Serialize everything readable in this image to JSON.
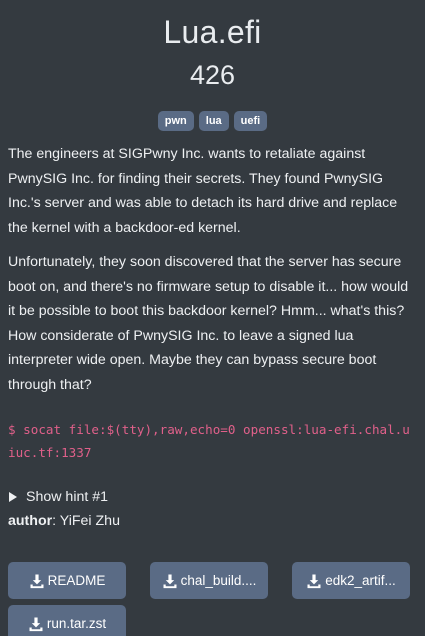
{
  "challenge": {
    "title": "Lua.efi",
    "points": "426",
    "tags": [
      "pwn",
      "lua",
      "uefi"
    ],
    "description": [
      "The engineers at SIGPwny Inc. wants to retaliate against PwnySIG Inc. for finding their secrets. They found PwnySIG Inc.'s server and was able to detach its hard drive and replace the kernel with a backdoor-ed kernel.",
      "Unfortunately, they soon discovered that the server has secure boot on, and there's no firmware setup to disable it... how would it be possible to boot this backdoor kernel? Hmm... what's this? How considerate of PwnySIG Inc. to leave a signed lua interpreter wide open. Maybe they can bypass secure boot through that?"
    ],
    "command": "$ socat file:$(tty),raw,echo=0 openssl:lua-efi.chal.uiuc.tf:1337",
    "hint_label": "Show hint #1",
    "author_label": "author",
    "author_name": "YiFei Zhu"
  },
  "downloads": [
    {
      "label": "README",
      "icon": "download-icon"
    },
    {
      "label": "chal_build....",
      "icon": "download-icon"
    },
    {
      "label": "edk2_artif...",
      "icon": "download-icon"
    },
    {
      "label": "run.tar.zst",
      "icon": "download-icon"
    }
  ],
  "colors": {
    "background": "#343a40",
    "tag_background": "#5a6b85",
    "button_background": "#5a6b85",
    "command_text": "#e0608a"
  }
}
